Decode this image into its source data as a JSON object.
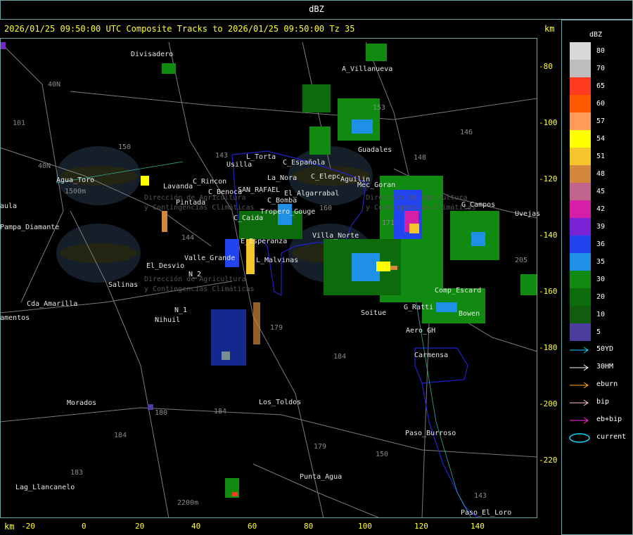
{
  "top_title": "dBZ",
  "header": {
    "text": "2026/01/25 09:50:00 UTC Composite Tracks to 2026/01/25 09:50:00 Tz 35",
    "km_label": "km"
  },
  "axes": {
    "y_ticks": [
      "-80",
      "-100",
      "-120",
      "-140",
      "-160",
      "-180",
      "-200",
      "-220"
    ],
    "x_ticks": [
      "-20",
      "0",
      "20",
      "40",
      "60",
      "80",
      "100",
      "120",
      "140"
    ],
    "x_unit": "km"
  },
  "legend": {
    "title": "dBZ",
    "scale": [
      {
        "value": "80",
        "color": "#d8d8d8"
      },
      {
        "value": "70",
        "color": "#bdbdbd"
      },
      {
        "value": "65",
        "color": "#ff3b1f"
      },
      {
        "value": "60",
        "color": "#ff5a00"
      },
      {
        "value": "57",
        "color": "#ff9a57"
      },
      {
        "value": "54",
        "color": "#ffff00"
      },
      {
        "value": "51",
        "color": "#f5c52c"
      },
      {
        "value": "48",
        "color": "#d4883e"
      },
      {
        "value": "45",
        "color": "#c0648e"
      },
      {
        "value": "42",
        "color": "#d61fa6"
      },
      {
        "value": "39",
        "color": "#7a22d6"
      },
      {
        "value": "36",
        "color": "#2244ee"
      },
      {
        "value": "35",
        "color": "#1e90e6"
      },
      {
        "value": "30",
        "color": "#108a10"
      },
      {
        "value": "20",
        "color": "#0c6c0c"
      },
      {
        "value": "10",
        "color": "#125c12"
      },
      {
        "value": "5",
        "color": "#4c3c9c"
      }
    ],
    "tracks": [
      {
        "label": "50YD",
        "color": "#19d4ff"
      },
      {
        "label": "30HM",
        "color": "#ffffff"
      },
      {
        "label": "eburn",
        "color": "#ffb020"
      },
      {
        "label": "bip",
        "color": "#ffc8d2"
      },
      {
        "label": "eb+bip",
        "color": "#ff2ce0"
      },
      {
        "label": "current",
        "color": "#19d4ff"
      }
    ]
  },
  "places": [
    "Divisadero",
    "A_Villanueva",
    "Guadales",
    "Usilla",
    "L_Torta",
    "C_Española",
    "La_Nora",
    "C_Elepc",
    "Aguilin",
    "Agua_Toro",
    "C_Rincon",
    "C_Benoca",
    "SAN_RAFAEL",
    "El_Algarrabal",
    "C_Bomba",
    "Mec_Goran",
    "Pintada",
    "Lavanda",
    "Pampa_Diamante",
    "C_Caida",
    "Tropero_Gouge",
    "G_Campos",
    "Uvejas",
    "Villa_Norte",
    "E_Esperanza",
    "Valle_Grande",
    "L_Malvinas",
    "El_Desvio",
    "Salinas",
    "N_2",
    "N_1",
    "Cda_Amarilla",
    "Nihuil",
    "Soitue",
    "G_Ratti",
    "Bowen",
    "Comp_Escard",
    "Aero_GH",
    "Carmensa",
    "Morados",
    "Los_Toldos",
    "Paso_Burroso",
    "Punta_Agua",
    "Lag_Llancanelo",
    "Paso_El_Loro",
    "amentos",
    "aula"
  ],
  "roads": [
    "101",
    "40N",
    "40N",
    "143",
    "150",
    "146",
    "153",
    "148",
    "144",
    "179",
    "184",
    "180",
    "184",
    "184",
    "183",
    "179",
    "150",
    "143",
    "205",
    "160",
    "171",
    "1500m",
    "2200m"
  ],
  "watermark": {
    "logo_text": "DACC",
    "line1": "Dirección de Agricultura",
    "line2": "y Contingencias Climáticas"
  }
}
